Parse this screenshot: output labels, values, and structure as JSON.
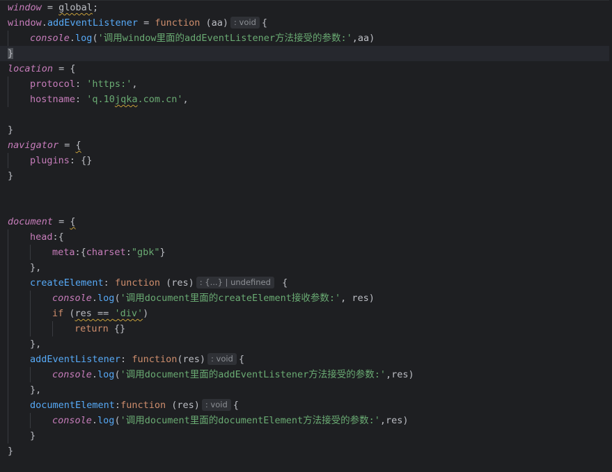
{
  "editor": {
    "lines": [
      {
        "indent": 0,
        "tokens": [
          {
            "t": "window",
            "c": "ivar"
          },
          {
            "t": " = ",
            "c": "op"
          },
          {
            "t": "global",
            "c": "var",
            "sq": true
          },
          {
            "t": ";",
            "c": "punc"
          }
        ]
      },
      {
        "indent": 0,
        "tokens": [
          {
            "t": "window",
            "c": "prop"
          },
          {
            "t": ".",
            "c": "punc"
          },
          {
            "t": "addEventListener",
            "c": "method"
          },
          {
            "t": " = ",
            "c": "op"
          },
          {
            "t": "function",
            "c": "kw"
          },
          {
            "t": " (aa)",
            "c": "var"
          },
          {
            "hint": ": void"
          },
          {
            "t": "{",
            "c": "punc"
          }
        ]
      },
      {
        "indent": 1,
        "tokens": [
          {
            "t": "console",
            "c": "ivar"
          },
          {
            "t": ".",
            "c": "punc"
          },
          {
            "t": "log",
            "c": "fn"
          },
          {
            "t": "(",
            "c": "punc"
          },
          {
            "t": "'调用window里面的addEventListener方法接受的参数:'",
            "c": "str"
          },
          {
            "t": ",aa)",
            "c": "var"
          }
        ]
      },
      {
        "indent": 0,
        "current": true,
        "tokens": [
          {
            "t": "}",
            "c": "caret"
          }
        ]
      },
      {
        "indent": 0,
        "tokens": [
          {
            "t": "location",
            "c": "ivar"
          },
          {
            "t": " = {",
            "c": "op"
          }
        ]
      },
      {
        "indent": 1,
        "tokens": [
          {
            "t": "protocol",
            "c": "prop"
          },
          {
            "t": ": ",
            "c": "punc"
          },
          {
            "t": "'https:'",
            "c": "str"
          },
          {
            "t": ",",
            "c": "punc"
          }
        ]
      },
      {
        "indent": 1,
        "tokens": [
          {
            "t": "hostname",
            "c": "prop"
          },
          {
            "t": ": ",
            "c": "punc"
          },
          {
            "t": "'q.10",
            "c": "str"
          },
          {
            "t": "jqka",
            "c": "str",
            "sq": true
          },
          {
            "t": ".com.cn'",
            "c": "str"
          },
          {
            "t": ",",
            "c": "punc"
          }
        ]
      },
      {
        "indent": 0,
        "tokens": []
      },
      {
        "indent": 0,
        "tokens": [
          {
            "t": "}",
            "c": "punc"
          }
        ]
      },
      {
        "indent": 0,
        "tokens": [
          {
            "t": "navigator",
            "c": "ivar"
          },
          {
            "t": " = ",
            "c": "op"
          },
          {
            "t": "{",
            "c": "punc",
            "sq": true
          }
        ]
      },
      {
        "indent": 1,
        "tokens": [
          {
            "t": "plugins",
            "c": "prop"
          },
          {
            "t": ": {}",
            "c": "punc"
          }
        ]
      },
      {
        "indent": 0,
        "tokens": [
          {
            "t": "}",
            "c": "punc"
          }
        ]
      },
      {
        "indent": 0,
        "tokens": []
      },
      {
        "indent": 0,
        "tokens": []
      },
      {
        "indent": 0,
        "tokens": [
          {
            "t": "document",
            "c": "ivar"
          },
          {
            "t": " = ",
            "c": "op"
          },
          {
            "t": "{",
            "c": "punc",
            "sq": true
          }
        ]
      },
      {
        "indent": 1,
        "tokens": [
          {
            "t": "head",
            "c": "prop"
          },
          {
            "t": ":{",
            "c": "punc"
          }
        ]
      },
      {
        "indent": 2,
        "tokens": [
          {
            "t": "meta",
            "c": "prop"
          },
          {
            "t": ":{",
            "c": "punc"
          },
          {
            "t": "charset",
            "c": "prop"
          },
          {
            "t": ":",
            "c": "punc"
          },
          {
            "t": "\"gbk\"",
            "c": "str"
          },
          {
            "t": "}",
            "c": "punc"
          }
        ]
      },
      {
        "indent": 1,
        "tokens": [
          {
            "t": "},",
            "c": "punc"
          }
        ]
      },
      {
        "indent": 1,
        "tokens": [
          {
            "t": "createElement",
            "c": "method"
          },
          {
            "t": ": ",
            "c": "punc"
          },
          {
            "t": "function",
            "c": "kw"
          },
          {
            "t": " (res)",
            "c": "var"
          },
          {
            "hint": ": {...} | undefined"
          },
          {
            "t": " {",
            "c": "punc"
          }
        ]
      },
      {
        "indent": 2,
        "tokens": [
          {
            "t": "console",
            "c": "ivar"
          },
          {
            "t": ".",
            "c": "punc"
          },
          {
            "t": "log",
            "c": "fn"
          },
          {
            "t": "(",
            "c": "punc"
          },
          {
            "t": "'调用document里面的createElement接收参数:'",
            "c": "str"
          },
          {
            "t": ", res)",
            "c": "var"
          }
        ]
      },
      {
        "indent": 2,
        "tokens": [
          {
            "t": "if",
            "c": "kw"
          },
          {
            "t": " (",
            "c": "punc"
          },
          {
            "t": "res == ",
            "c": "var",
            "sq": true
          },
          {
            "t": "'div'",
            "c": "str",
            "sq": true
          },
          {
            "t": ")",
            "c": "punc"
          }
        ]
      },
      {
        "indent": 3,
        "tokens": [
          {
            "t": "return",
            "c": "kw"
          },
          {
            "t": " {}",
            "c": "punc"
          }
        ]
      },
      {
        "indent": 1,
        "tokens": [
          {
            "t": "},",
            "c": "punc"
          }
        ]
      },
      {
        "indent": 1,
        "tokens": [
          {
            "t": "addEventListener",
            "c": "method"
          },
          {
            "t": ": ",
            "c": "punc"
          },
          {
            "t": "function",
            "c": "kw"
          },
          {
            "t": "(res)",
            "c": "var"
          },
          {
            "hint": ": void"
          },
          {
            "t": "{",
            "c": "punc"
          }
        ]
      },
      {
        "indent": 2,
        "tokens": [
          {
            "t": "console",
            "c": "ivar"
          },
          {
            "t": ".",
            "c": "punc"
          },
          {
            "t": "log",
            "c": "fn"
          },
          {
            "t": "(",
            "c": "punc"
          },
          {
            "t": "'调用document里面的addEventListener方法接受的参数:'",
            "c": "str"
          },
          {
            "t": ",res)",
            "c": "var"
          }
        ]
      },
      {
        "indent": 1,
        "tokens": [
          {
            "t": "},",
            "c": "punc"
          }
        ]
      },
      {
        "indent": 1,
        "tokens": [
          {
            "t": "documentElement",
            "c": "method"
          },
          {
            "t": ":",
            "c": "punc"
          },
          {
            "t": "function",
            "c": "kw"
          },
          {
            "t": " (res)",
            "c": "var"
          },
          {
            "hint": ": void"
          },
          {
            "t": "{",
            "c": "punc"
          }
        ]
      },
      {
        "indent": 2,
        "tokens": [
          {
            "t": "console",
            "c": "ivar"
          },
          {
            "t": ".",
            "c": "punc"
          },
          {
            "t": "log",
            "c": "fn"
          },
          {
            "t": "(",
            "c": "punc"
          },
          {
            "t": "'调用document里面的documentElement方法接受的参数:'",
            "c": "str"
          },
          {
            "t": ",res)",
            "c": "var"
          }
        ]
      },
      {
        "indent": 1,
        "tokens": [
          {
            "t": "}",
            "c": "punc"
          }
        ]
      },
      {
        "indent": 0,
        "tokens": [
          {
            "t": "}",
            "c": "punc"
          }
        ]
      }
    ]
  }
}
